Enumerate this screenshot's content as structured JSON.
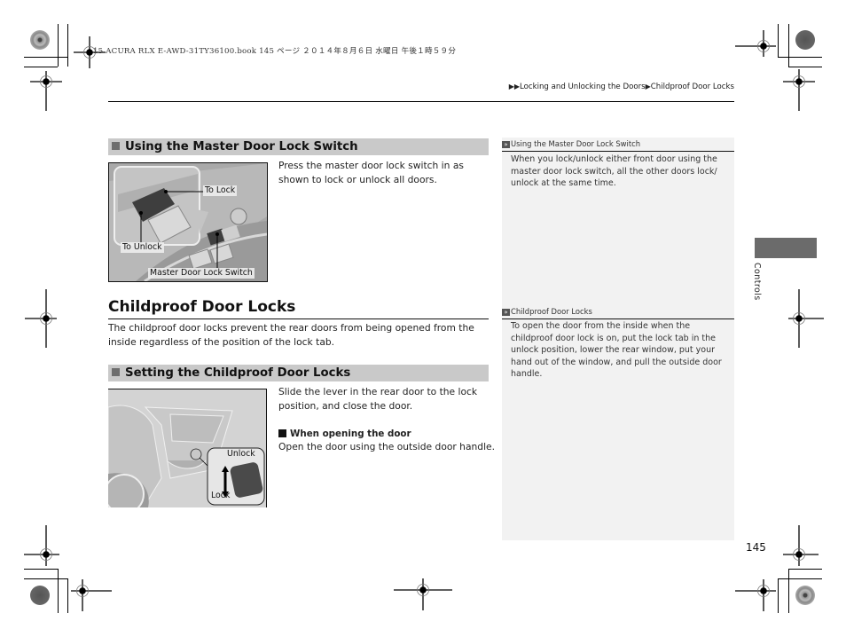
{
  "print_header": "15 ACURA RLX E-AWD-31TY36100.book  145 ページ  ２０１４年８月６日  水曜日  午後１時５９分",
  "breadcrumb": {
    "items": [
      "Locking and Unlocking the Doors",
      "Childproof Door Locks"
    ],
    "separator_icon": "triangle-right-icon"
  },
  "sections": {
    "master_switch": {
      "title": "Using the Master Door Lock Switch",
      "body": "Press the master door lock switch in as shown to lock or unlock all doors.",
      "figure": {
        "callouts": [
          "To Lock",
          "To Unlock",
          "Master Door Lock Switch"
        ]
      }
    },
    "childproof": {
      "heading": "Childproof Door Locks",
      "intro": "The childproof door locks prevent the rear doors from being opened from the inside regardless of the position of the lock tab.",
      "setting": {
        "title": "Setting the Childproof Door Locks",
        "body": "Slide the lever in the rear door to the lock position, and close the door.",
        "subheading": "When opening the door",
        "sub_body": "Open the door using the outside door handle.",
        "figure": {
          "callouts": [
            "Unlock",
            "Lock"
          ]
        }
      }
    }
  },
  "sidebar_notes": [
    {
      "title": "Using the Master Door Lock Switch",
      "text": "When you lock/unlock either front door using the master door lock switch, all the other doors lock/ unlock at the same time."
    },
    {
      "title": "Childproof Door Locks",
      "text": "To open the door from the inside when the childproof door lock is on, put the lock tab in the unlock position, lower the rear window, put your hand out of the window, and pull the outside door handle."
    }
  ],
  "side_tab": {
    "label": "Controls"
  },
  "page_number": "145"
}
